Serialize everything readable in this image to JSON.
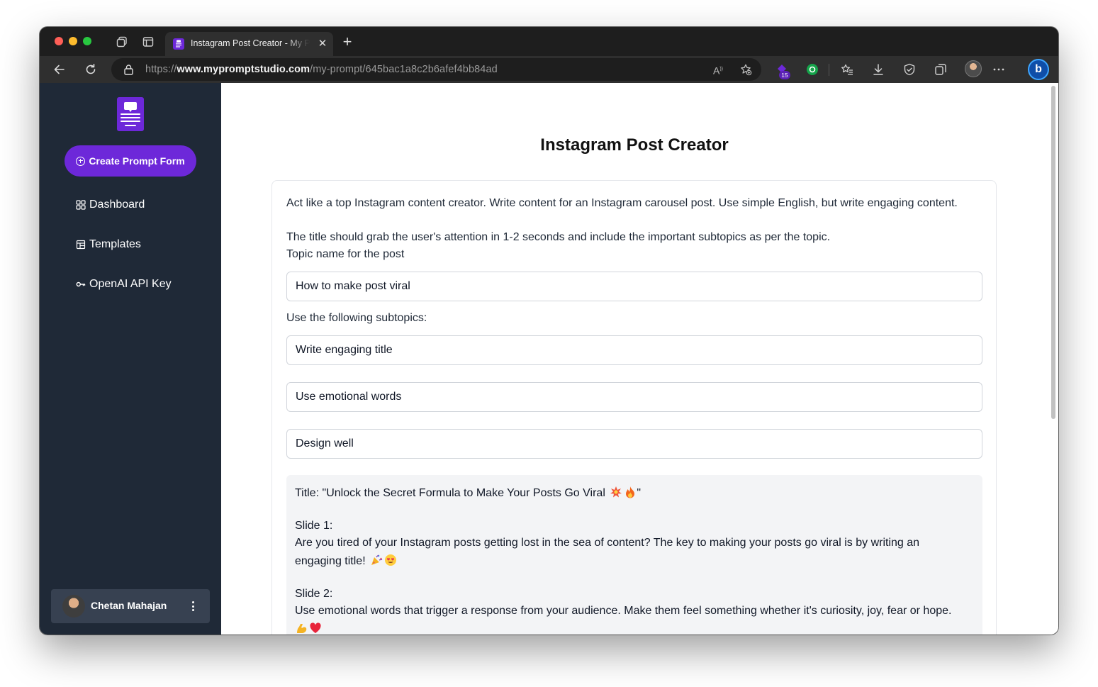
{
  "browser": {
    "tab_title": "Instagram Post Creator - My Prompt Studio",
    "url_scheme": "https://",
    "url_host": "www.mypromptstudio.com",
    "url_path": "/my-prompt/645bac1a8c2b6afef4bb84ad",
    "read_aloud_label": "A",
    "extension_badge_count": "15",
    "copilot_label": "b"
  },
  "sidebar": {
    "create_button_label": "Create Prompt Form",
    "nav": [
      {
        "label": "Dashboard",
        "icon": "dashboard-grid-icon"
      },
      {
        "label": "Templates",
        "icon": "templates-icon"
      },
      {
        "label": "OpenAI API Key",
        "icon": "key-icon"
      }
    ],
    "user_name": "Chetan Mahajan"
  },
  "main": {
    "title": "Instagram Post Creator",
    "prompt_intro": "Act like a top Instagram content creator. Write content for an Instagram carousel post. Use simple English, but write engaging content.",
    "prompt_title_rule": "The title should grab the user's attention in 1-2 seconds and include the important subtopics as per the topic.",
    "topic_label": "Topic name for the post",
    "topic_value": "How to make post viral",
    "subtopics_label": "Use the following subtopics:",
    "subtopics": [
      "Write engaging title",
      "Use emotional words",
      "Design well"
    ],
    "output": {
      "title_line": "Title: \"Unlock the Secret Formula to Make Your Posts Go Viral",
      "title_emojis": [
        "collision-emoji",
        "fire-emoji"
      ],
      "title_end": "\"",
      "slide1_heading": "Slide 1:",
      "slide1_line1": "Are you tired of your Instagram posts getting lost in the sea of content? The key to making your posts go viral is by writing an",
      "slide1_line2": "engaging title!",
      "slide1_emojis": [
        "party-popper-emoji",
        "heart-eyes-emoji"
      ],
      "slide2_heading": "Slide 2:",
      "slide2_line1": "Use emotional words that trigger a response from your audience. Make them feel something whether it's curiosity, joy, fear or hope.",
      "slide2_emojis": [
        "flexed-biceps-emoji",
        "red-heart-emoji"
      ]
    }
  },
  "colors": {
    "brand_purple": "#6d28d9",
    "sidebar_bg": "#1f2937",
    "user_card_bg": "#374151",
    "output_bg": "#f3f4f6"
  }
}
